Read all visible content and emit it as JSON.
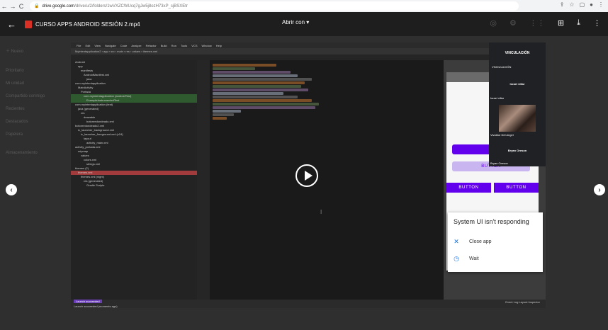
{
  "browser": {
    "back": "←",
    "forward": "→",
    "reload": "C",
    "url_host": "drive.google.com",
    "url_path": "/drive/u/2/folders/1wVXZCWUcq7gJw5j8ozH73xP_sjBSXEtr",
    "icons": [
      "share-icon",
      "star-icon",
      "extensions-icon",
      "profile-icon",
      "menu-icon"
    ]
  },
  "viewer": {
    "file_name": "CURSO APPS ANDROID SESIÓN 2.mp4",
    "open_with": "Abrir con",
    "icons": [
      "add-to-drive-icon",
      "download-icon",
      "more-icon"
    ]
  },
  "drive_ghost": {
    "new_button": "Nuevo",
    "items": [
      "Prioritario",
      "Mi unidad",
      "Compartido conmigo",
      "Recientes",
      "Destacados",
      "Papelera",
      "Almacenamiento"
    ]
  },
  "ide": {
    "menu": [
      "File",
      "Edit",
      "View",
      "Navigate",
      "Code",
      "Analyze",
      "Refactor",
      "Build",
      "Run",
      "Tools",
      "VCS",
      "Window",
      "Help"
    ],
    "path": "Myintentapplication2 › app › src › main › res › values › themes.xml",
    "project_rows": [
      {
        "label": "Android",
        "cls": ""
      },
      {
        "label": "app",
        "cls": ""
      },
      {
        "label": "manifests",
        "cls": ""
      },
      {
        "label": "AndroidManifest.xml",
        "cls": ""
      },
      {
        "label": "java",
        "cls": ""
      },
      {
        "label": "com.myintentapplication",
        "cls": ""
      },
      {
        "label": "MainActivity",
        "cls": ""
      },
      {
        "label": "Portada",
        "cls": ""
      },
      {
        "label": "com.myintentapplication (androidTest)",
        "cls": "hl"
      },
      {
        "label": "ExampleInstrumentedTest",
        "cls": "hl"
      },
      {
        "label": "com.myintentapplication (test)",
        "cls": ""
      },
      {
        "label": "java (generated)",
        "cls": ""
      },
      {
        "label": "res",
        "cls": ""
      },
      {
        "label": "drawable",
        "cls": ""
      },
      {
        "label": "botonredondeado.xml",
        "cls": ""
      },
      {
        "label": "botonredondeado2.xml",
        "cls": ""
      },
      {
        "label": "ic_launcher_background.xml",
        "cls": ""
      },
      {
        "label": "ic_launcher_foreground.xml (v24)",
        "cls": ""
      },
      {
        "label": "layout",
        "cls": ""
      },
      {
        "label": "activity_main.xml",
        "cls": ""
      },
      {
        "label": "activity_portada.xml",
        "cls": ""
      },
      {
        "label": "mipmap",
        "cls": ""
      },
      {
        "label": "values",
        "cls": ""
      },
      {
        "label": "colors.xml",
        "cls": ""
      },
      {
        "label": "strings.xml",
        "cls": ""
      },
      {
        "label": "themes (2)",
        "cls": ""
      },
      {
        "label": "themes.xml",
        "cls": "sel"
      },
      {
        "label": "themes.xml (night)",
        "cls": ""
      },
      {
        "label": "res (generated)",
        "cls": ""
      },
      {
        "label": "Gradle Scripts",
        "cls": ""
      }
    ],
    "status_left": "Launch succeeded (moments ago)",
    "status_toast": "Launch succeeded",
    "status_tabs": [
      "Run",
      "TODO",
      "Problems",
      "Terminal",
      "Build",
      "Logcat",
      "Profiler",
      "App Inspection"
    ],
    "status_right": "Event Log   Layout Inspector"
  },
  "phone": {
    "button_a": "BUTTON",
    "button_b": "BUTTON",
    "button_c": "BUTTON"
  },
  "dialog": {
    "title": "System UI isn't responding",
    "close": "Close app",
    "wait": "Wait"
  },
  "meet": {
    "title": "VINCULACIÓN",
    "header_label": "VINCULACIÓN",
    "p1": "Israel villar",
    "p1_label": "Israel villar",
    "p2_label": "Vivaldor Del Angel",
    "p3": "Bryan Oreson",
    "p3_label": "Bryan Oreson"
  },
  "code_colors": [
    "#cc7832",
    "#6a8759",
    "#9876aa",
    "#a9b7c6",
    "#808080"
  ]
}
